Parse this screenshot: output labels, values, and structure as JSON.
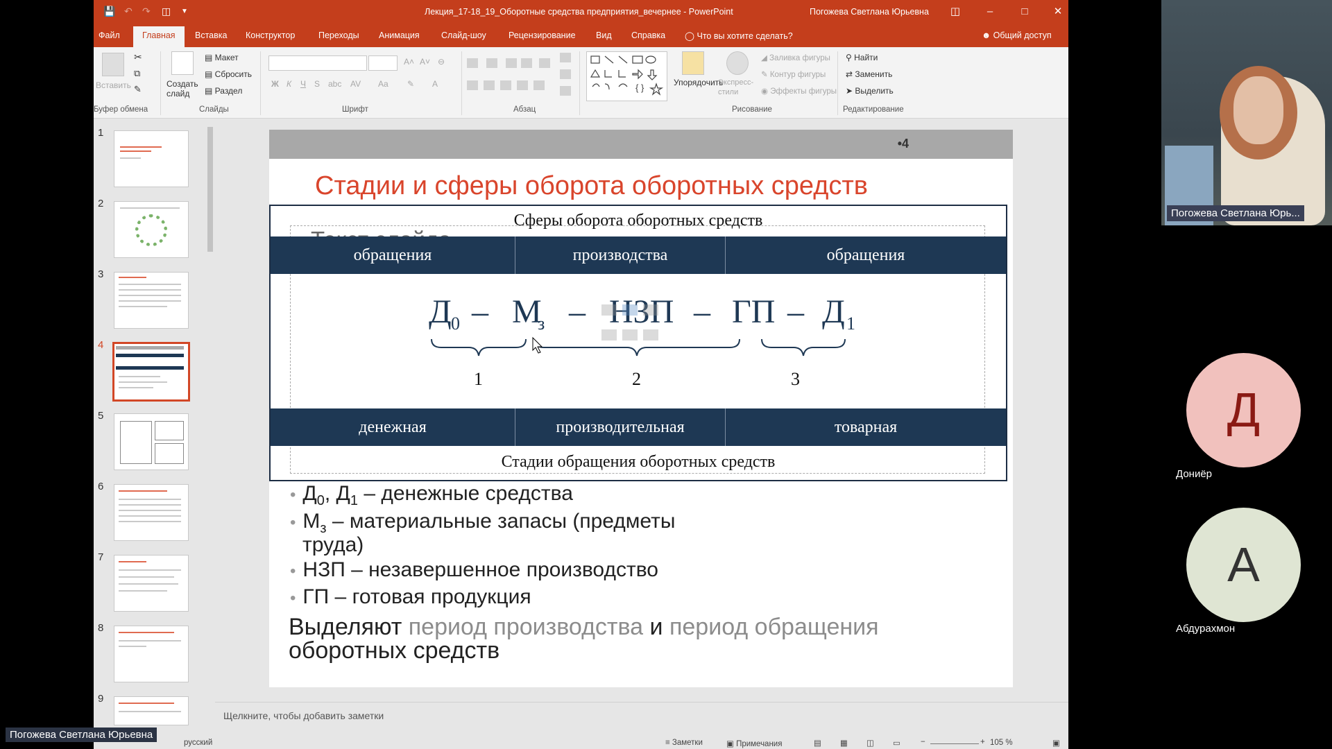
{
  "window": {
    "doc_title": "Лекция_17-18_19_Оборотные средства предприятия_вечернее - PowerPoint",
    "user_name": "Погожева Светлана Юрьевна"
  },
  "tabs": [
    "Файл",
    "Главная",
    "Вставка",
    "Конструктор",
    "Переходы",
    "Анимация",
    "Слайд-шоу",
    "Рецензирование",
    "Вид",
    "Справка"
  ],
  "tell_me": "Что вы хотите сделать?",
  "share": "Общий доступ",
  "ribbon": {
    "paste": "Вставить",
    "new_slide": "Создать слайд",
    "layout": "Макет",
    "reset": "Сбросить",
    "section": "Раздел",
    "arrange": "Упорядочить",
    "express_styles": "Экспресс-стили",
    "shape_fill": "Заливка фигуры",
    "shape_outline": "Контур фигуры",
    "shape_effects": "Эффекты фигуры",
    "find": "Найти",
    "replace": "Заменить",
    "select": "Выделить",
    "groups": {
      "clipboard": "Буфер обмена",
      "slides": "Слайды",
      "font": "Шрифт",
      "paragraph": "Абзац",
      "drawing": "Рисование",
      "editing": "Редактирование"
    }
  },
  "thumbnails": [
    "1",
    "2",
    "3",
    "4",
    "5",
    "6",
    "7",
    "8",
    "9"
  ],
  "selected_slide": 4,
  "slide": {
    "number": "•4",
    "title": "Стадии и сферы оборота оборотных средств",
    "placeholder": "Текст слайда",
    "spheres_title": "Сферы оборота оборотных средств",
    "spheres": [
      "обращения",
      "производства",
      "обращения"
    ],
    "formula": {
      "d0": "Д",
      "d0_sub": "0",
      "m": "М",
      "m_sub": "з",
      "nzp": "НЗП",
      "gp": "ГП",
      "d1": "Д",
      "d1_sub": "1",
      "dash": "–",
      "stage_numbers": [
        "1",
        "2",
        "3"
      ]
    },
    "stages": [
      "денежная",
      "производительная",
      "товарная"
    ],
    "stages_title": "Стадии обращения оборотных средств",
    "bullets": [
      {
        "pre": "Д",
        "sub1": "0",
        "mid": ", Д",
        "sub2": "1",
        "post": " – денежные средства"
      },
      {
        "pre": "М",
        "sub1": "з",
        "post": " – материальные запасы (предметы",
        "cont": "труда)"
      },
      {
        "text": "НЗП – незавершенное производство"
      },
      {
        "text": "ГП – готовая продукция"
      }
    ],
    "closing": {
      "w1": "Выделяют ",
      "hl1": "период производства",
      "w2": " и ",
      "hl2": "период обращения",
      "line2": "оборотных средств"
    }
  },
  "notes_placeholder": "Щелкните, чтобы добавить заметки",
  "status": {
    "language": "русский",
    "notes": "Заметки",
    "comments": "Примечания",
    "zoom": "105 %"
  },
  "participants": {
    "presenter_label": "Погожева Светлана Юрь...",
    "p1_initial": "Д",
    "p1_name": "Дониёр",
    "p1_color": "#f1c1bd",
    "p2_initial": "А",
    "p2_name": "Абдурахмон",
    "p2_color": "#dfe5d3"
  },
  "bottom_badge": "Погожева Светлана Юрьевна"
}
